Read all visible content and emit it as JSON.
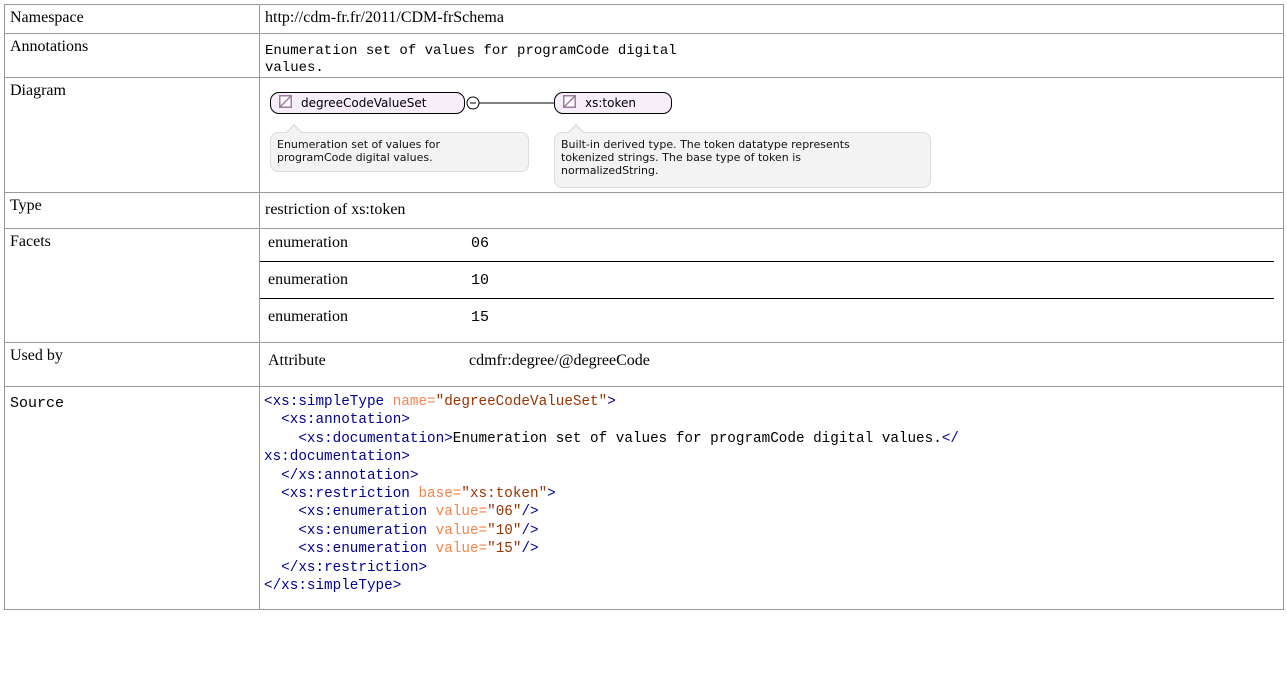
{
  "rows": {
    "namespace": {
      "label": "Namespace",
      "value": "http://cdm-fr.fr/2011/CDM-frSchema"
    },
    "annotations": {
      "label": "Annotations",
      "line1": "Enumeration set of values for programCode digital",
      "line2": "values."
    },
    "diagram": {
      "label": "Diagram",
      "node1": "degreeCodeValueSet",
      "node2": "xs:token",
      "note1_line1": "Enumeration set of values for",
      "note1_line2": "programCode digital values.",
      "note2_line1": "Built-in derived type. The token datatype represents",
      "note2_line2": "tokenized strings. The base type of token is",
      "note2_line3": "normalizedString.",
      "colors": {
        "node_fill": "#f6eef8",
        "icon_stroke": "#a07aa0",
        "note_fill": "#f3f3f3"
      }
    },
    "type": {
      "label": "Type",
      "value": "restriction of xs:token"
    },
    "facets": {
      "label": "Facets",
      "items": [
        {
          "name": "enumeration",
          "value": "06"
        },
        {
          "name": "enumeration",
          "value": "10"
        },
        {
          "name": "enumeration",
          "value": "15"
        }
      ]
    },
    "used_by": {
      "label": "Used by",
      "kind": "Attribute",
      "value": "cdmfr:degree/@degreeCode"
    },
    "source": {
      "label": "Source",
      "colors": {
        "tag": "#000096",
        "attr": "#f5844c",
        "value": "#993300"
      },
      "l1_open": "<xs:simpleType",
      "l1_attr": "name=",
      "l1_val": "\"degreeCodeValueSet\"",
      "l1_close": ">",
      "l2": "<xs:annotation>",
      "l3_open": "<xs:documentation>",
      "l3_text": "Enumeration set of values for programCode digital values.",
      "l3_close": "</",
      "l4": "xs:documentation>",
      "l5": "</xs:annotation>",
      "l6_open": "<xs:restriction",
      "l6_attr": "base=",
      "l6_val": "\"xs:token\"",
      "l6_close": ">",
      "enum_open": "<xs:enumeration",
      "enum_attr": "value=",
      "e1_val": "\"06\"",
      "e2_val": "\"10\"",
      "e3_val": "\"15\"",
      "enum_close": "/>",
      "l10": "</xs:restriction>",
      "l11": "</xs:simpleType>"
    }
  }
}
